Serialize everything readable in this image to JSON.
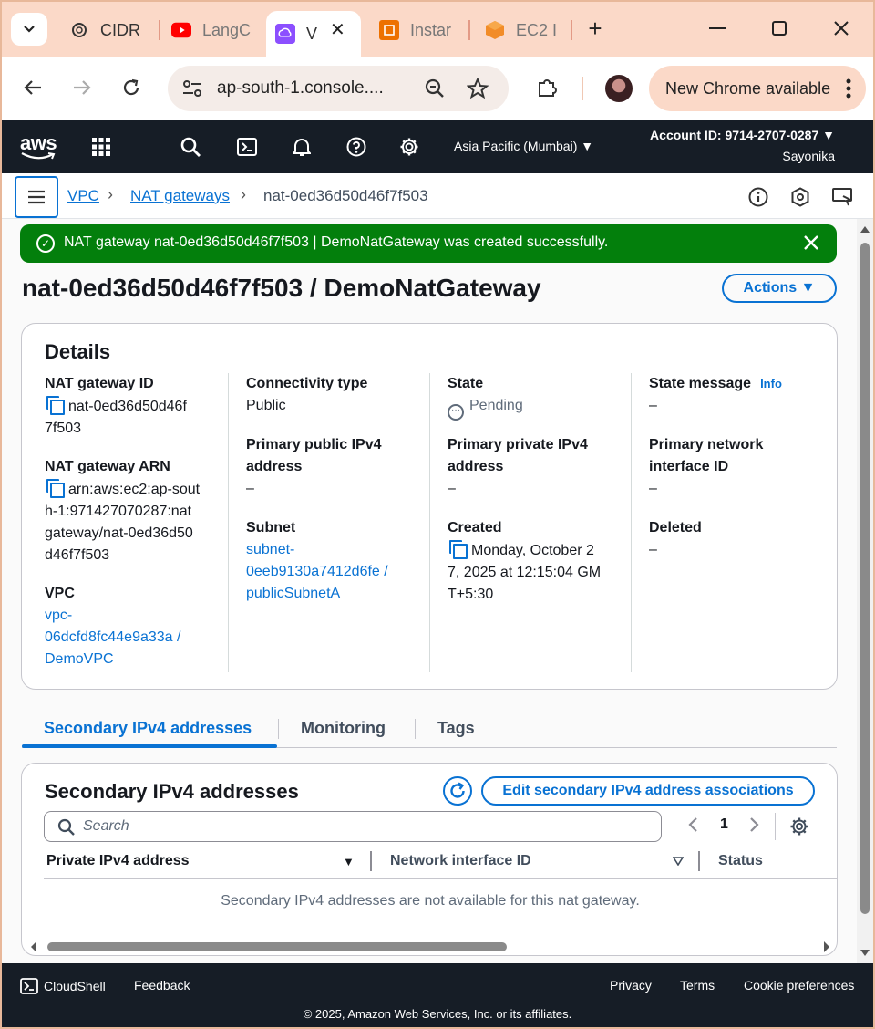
{
  "browser": {
    "tabs": [
      {
        "label": "CIDR"
      },
      {
        "label": "LangC"
      },
      {
        "label": "V"
      },
      {
        "label": "Instar"
      },
      {
        "label": "EC2 I"
      }
    ],
    "new_tab": "+",
    "url": "ap-south-1.console....",
    "new_chrome_label": "New Chrome available"
  },
  "aws_header": {
    "logo": "aws",
    "region": "Asia Pacific (Mumbai) ▼",
    "account": "Account ID: 9714-2707-0287 ▼",
    "user": "Sayonika"
  },
  "breadcrumb": {
    "items": [
      "VPC",
      "NAT gateways",
      "nat-0ed36d50d46f7f503"
    ],
    "sep": "›"
  },
  "flash": {
    "message": "NAT gateway nat-0ed36d50d46f7f503 | DemoNatGateway was created successfully.",
    "color": "#037f0c"
  },
  "page": {
    "title": "nat-0ed36d50d46f7f503 / DemoNatGateway",
    "actions_label": "Actions ▼"
  },
  "details": {
    "title": "Details",
    "nat_id_label": "NAT gateway ID",
    "nat_id_l1": "nat-0ed36d50d46f",
    "nat_id_l2": "7f503",
    "arn_label": "NAT gateway ARN",
    "arn_l1": "arn:aws:ec2:ap-sout",
    "arn_l2": "h-1:971427070287:nat",
    "arn_l3": "gateway/nat-0ed36d50",
    "arn_l4": "d46f7f503",
    "vpc_label": "VPC",
    "vpc_l1": "vpc-",
    "vpc_l2": "06dcfd8fc44e9a33a /",
    "vpc_l3": "DemoVPC",
    "conn_label": "Connectivity type",
    "conn_value": "Public",
    "pub_ip_l1": "Primary public IPv4",
    "pub_ip_l2": "address",
    "pub_ip_value": "–",
    "subnet_label": "Subnet",
    "subnet_l1": "subnet-",
    "subnet_l2": "0eeb9130a7412d6fe /",
    "subnet_l3": "publicSubnetA",
    "state_label": "State",
    "state_value": "Pending",
    "priv_ip_l1": "Primary private IPv4",
    "priv_ip_l2": "address",
    "priv_ip_value": "–",
    "created_label": "Created",
    "created_l1": "Monday, October 2",
    "created_l2": "7, 2025 at 12:15:04 GM",
    "created_l3": "T+5:30",
    "state_msg_label": "State message",
    "info_label": "Info",
    "state_msg_value": "–",
    "eni_l1": "Primary network",
    "eni_l2": "interface ID",
    "eni_value": "–",
    "deleted_label": "Deleted",
    "deleted_value": "–"
  },
  "tabs": [
    {
      "label": "Secondary IPv4 addresses"
    },
    {
      "label": "Monitoring"
    },
    {
      "label": "Tags"
    }
  ],
  "secondary": {
    "title": "Secondary IPv4 addresses",
    "edit_label": "Edit secondary IPv4 address associations",
    "search_placeholder": "Search",
    "page_number": "1",
    "columns": [
      "Private IPv4 address",
      "Network interface ID",
      "Status"
    ],
    "empty_message": "Secondary IPv4 addresses are not available for this nat gateway."
  },
  "footer": {
    "cloudshell": "CloudShell",
    "feedback": "Feedback",
    "privacy": "Privacy",
    "terms": "Terms",
    "cookies": "Cookie preferences",
    "copyright": "© 2025, Amazon Web Services, Inc. or its affiliates."
  },
  "colors": {
    "aws_nav": "#161d26",
    "link": "#0972d3",
    "success": "#037f0c",
    "tab_strip": "#fbd9c8"
  }
}
